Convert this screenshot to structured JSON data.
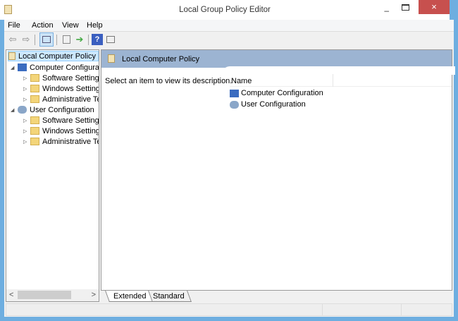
{
  "window": {
    "title": "Local Group Policy Editor",
    "close_icon": "×",
    "minimize_icon": "–"
  },
  "menu": [
    "File",
    "Action",
    "View",
    "Help"
  ],
  "toolbar": {
    "back": "⇦",
    "forward": "⇨",
    "help": "?"
  },
  "tree": {
    "root": "Local Computer Policy",
    "computer": {
      "label": "Computer Configura",
      "children": [
        "Software Settings",
        "Windows Setting",
        "Administrative Te"
      ]
    },
    "user": {
      "label": "User Configuration",
      "children": [
        "Software Settings",
        "Windows Setting",
        "Administrative Te"
      ]
    }
  },
  "right": {
    "header": "Local Computer Policy",
    "description": "Select an item to view its description.",
    "column": "Name",
    "items": [
      "Computer Configuration",
      "User Configuration"
    ]
  },
  "tabs": [
    "Extended",
    "Standard"
  ],
  "scroll": {
    "left": "<",
    "right": ">"
  }
}
